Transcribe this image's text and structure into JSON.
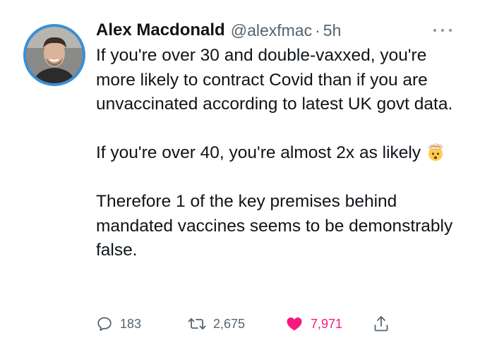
{
  "tweet": {
    "author_name": "Alex Macdonald",
    "handle": "@alexfmac",
    "separator": "·",
    "time": "5h",
    "paragraph1": "If you're over 30 and double-vaxxed, you're more likely to contract Covid than if you are unvaccinated according to latest UK govt data.",
    "paragraph2": "If you're over 40, you're almost 2x as likely",
    "paragraph2_emoji": "exploding-head-emoji",
    "paragraph3": "Therefore 1 of the key premises behind mandated vaccines seems to be demonstrably false."
  },
  "actions": {
    "replies": "183",
    "retweets": "2,675",
    "likes": "7,971"
  },
  "icons": {
    "reply": "reply-icon",
    "retweet": "retweet-icon",
    "like": "heart-icon",
    "share": "share-icon",
    "more": "more-icon"
  },
  "colors": {
    "text": "#0f1419",
    "secondary": "#536471",
    "like": "#f91880",
    "avatar_ring": "#3b8fd6"
  }
}
